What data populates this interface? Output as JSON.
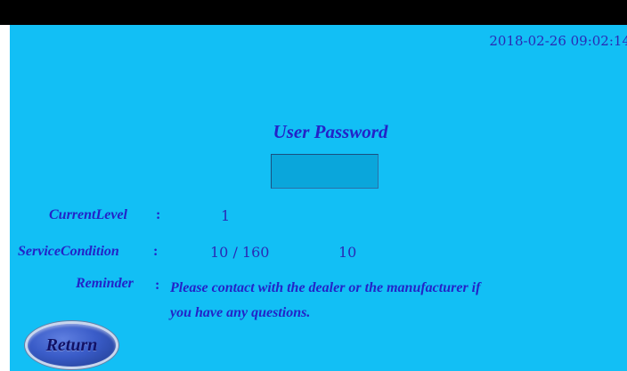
{
  "status": {
    "datetime": "2018-02-26 09:02:14"
  },
  "page": {
    "title": "User Password"
  },
  "password": {
    "value": ""
  },
  "current_level": {
    "label": "CurrentLevel",
    "colon": ":",
    "value": "1"
  },
  "service_condition": {
    "label": "ServiceCondition",
    "colon": ":",
    "used": "10 / 160",
    "remaining": "10"
  },
  "reminder": {
    "label": "Reminder",
    "colon": ":",
    "line1": "Please contact with the dealer or the manufacturer if",
    "line2": "you have any questions."
  },
  "buttons": {
    "return_label": "Return"
  },
  "colors": {
    "screen_background": "#12bff5",
    "text": "#2323c8",
    "input_background": "#0aa6db",
    "button": "#3a5cc8"
  }
}
